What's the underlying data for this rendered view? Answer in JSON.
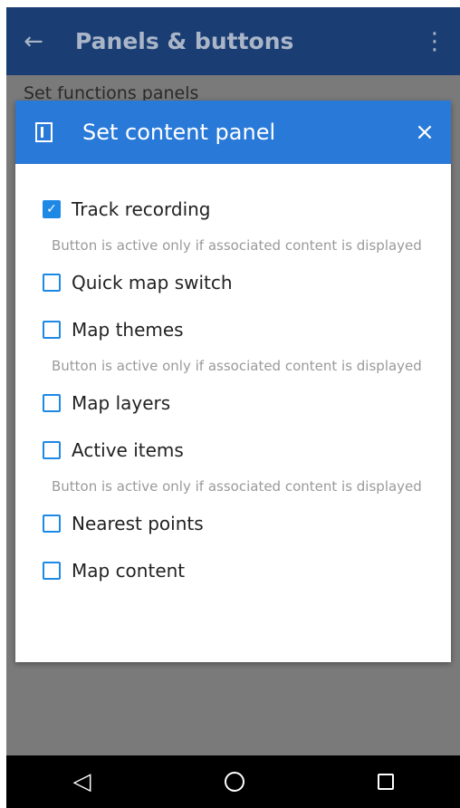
{
  "app_bar": {
    "title": "Panels & buttons",
    "back_icon": "←",
    "overflow_icon": "⋮"
  },
  "background": {
    "heading": "Set functions panels"
  },
  "dialog": {
    "title": "Set content panel",
    "close_icon": "×",
    "items": [
      {
        "label": "Track recording",
        "checked": true,
        "hint": "Button is active only if associated content is displayed"
      },
      {
        "label": "Quick map switch",
        "checked": false,
        "hint": ""
      },
      {
        "label": "Map themes",
        "checked": false,
        "hint": "Button is active only if associated content is displayed"
      },
      {
        "label": "Map layers",
        "checked": false,
        "hint": ""
      },
      {
        "label": "Active items",
        "checked": false,
        "hint": "Button is active only if associated content is displayed"
      },
      {
        "label": "Nearest points",
        "checked": false,
        "hint": ""
      },
      {
        "label": "Map content",
        "checked": false,
        "hint": ""
      }
    ]
  },
  "nav_bar": {
    "back_icon": "◁"
  },
  "colors": {
    "app_bar": "#1a3d73",
    "dialog_header": "#2979d8",
    "checkbox": "#1e88e5",
    "scrim": "#7a7a7a"
  }
}
